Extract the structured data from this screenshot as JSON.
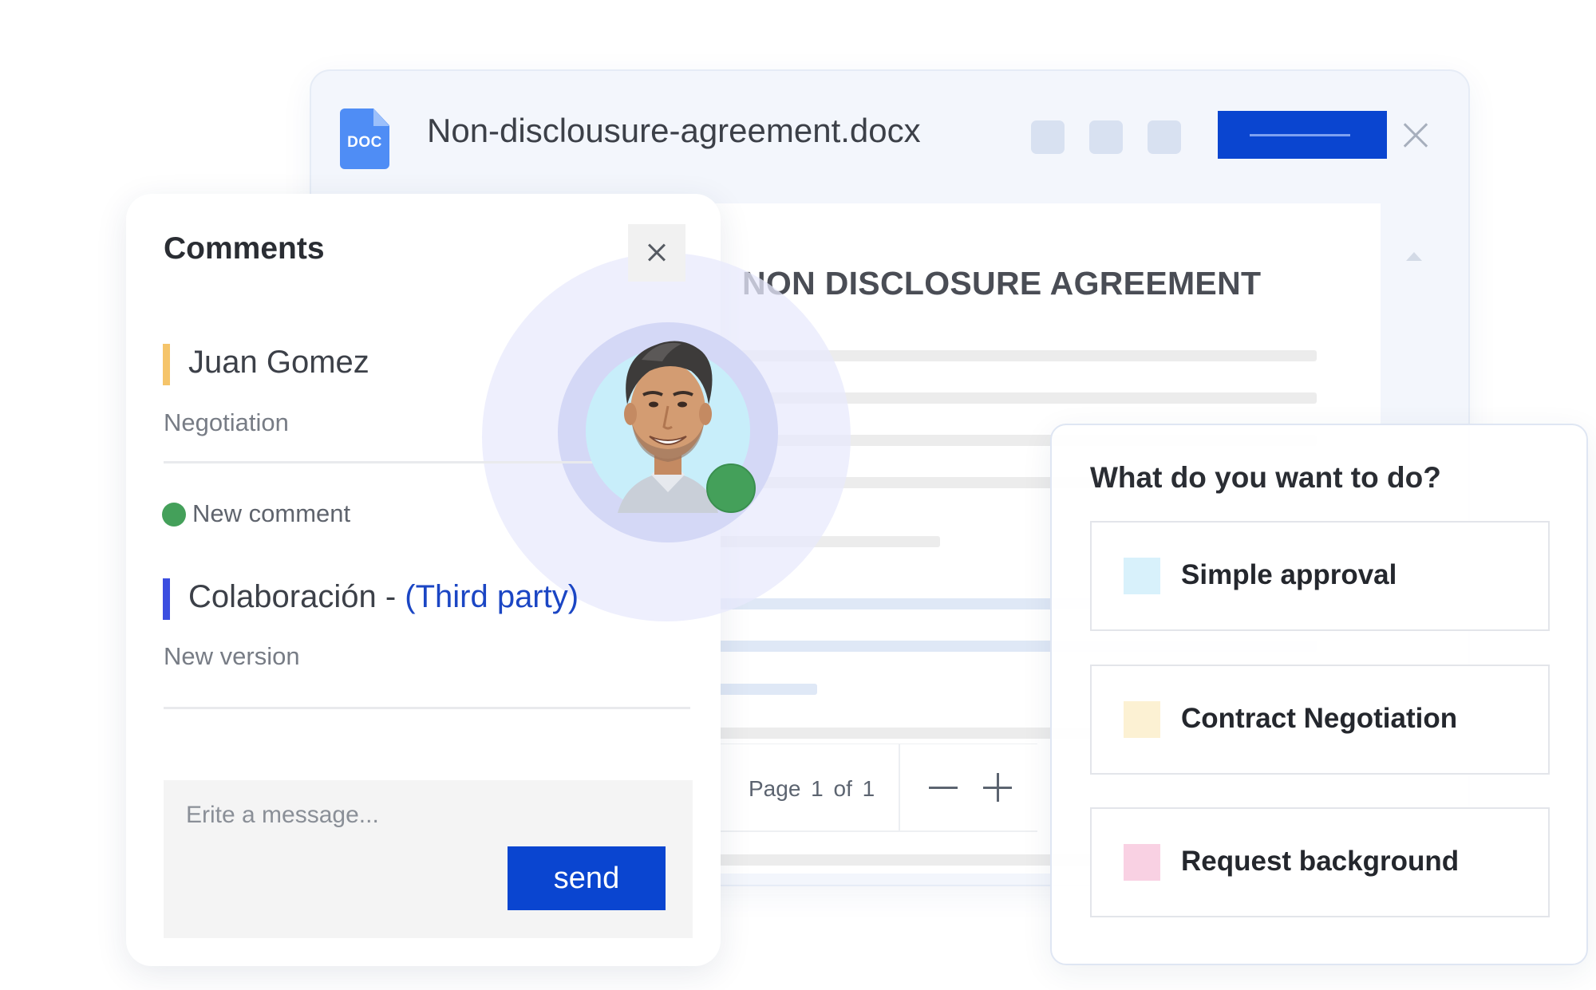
{
  "document": {
    "file_type": "DOC",
    "filename": "Non-disclousure-agreement.docx",
    "title": "NON DISCLOSURE AGREEMENT",
    "pagination": {
      "label": "Page 1 of 1"
    },
    "colors": {
      "accent": "#0a45d0",
      "icon": "#4f8df5"
    }
  },
  "comments": {
    "title": "Comments",
    "items": [
      {
        "author": "Juan Gomez",
        "subtitle": "Negotiation",
        "bar_color": "#f5c46a"
      },
      {
        "author": "Colaboración - ",
        "party": "(Third party)",
        "subtitle": "New version",
        "bar_color": "#3b4ee0"
      }
    ],
    "status": "New comment",
    "message": {
      "placeholder": "Erite a message...",
      "send_label": "send"
    }
  },
  "actions": {
    "title": "What do you want to do?",
    "options": [
      {
        "label": "Simple approval",
        "color": "#d8f1fb"
      },
      {
        "label": "Contract Negotiation",
        "color": "#fcf1d3"
      },
      {
        "label": "Request background",
        "color": "#f9d1e3"
      }
    ]
  }
}
